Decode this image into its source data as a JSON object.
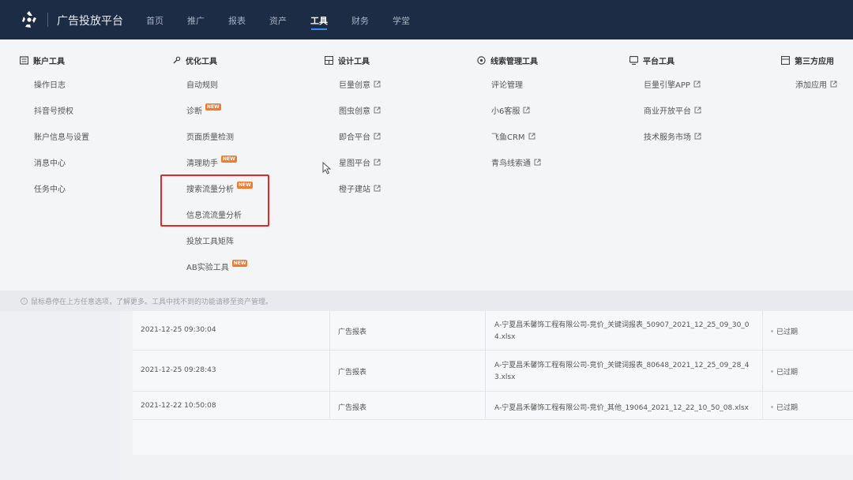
{
  "header": {
    "brand": "广告投放平台",
    "nav": [
      {
        "label": "首页",
        "active": false
      },
      {
        "label": "推广",
        "active": false
      },
      {
        "label": "报表",
        "active": false
      },
      {
        "label": "资产",
        "active": false
      },
      {
        "label": "工具",
        "active": true
      },
      {
        "label": "财务",
        "active": false
      },
      {
        "label": "学堂",
        "active": false
      }
    ]
  },
  "tools_menu": {
    "columns": [
      {
        "title": "账户工具",
        "icon": "account-tools-icon",
        "items": [
          {
            "label": "操作日志"
          },
          {
            "label": "抖音号授权"
          },
          {
            "label": "账户信息与设置"
          },
          {
            "label": "消息中心"
          },
          {
            "label": "任务中心"
          }
        ]
      },
      {
        "title": "优化工具",
        "icon": "wrench-icon",
        "items": [
          {
            "label": "自动规则"
          },
          {
            "label": "诊断",
            "badge": "NEW"
          },
          {
            "label": "页面质量检测"
          },
          {
            "label": "清理助手",
            "badge": "NEW"
          },
          {
            "label": "搜索流量分析",
            "badge": "NEW"
          },
          {
            "label": "信息流流量分析"
          },
          {
            "label": "投放工具矩阵"
          },
          {
            "label": "AB实验工具",
            "badge": "NEW"
          }
        ]
      },
      {
        "title": "设计工具",
        "icon": "design-tools-icon",
        "items": [
          {
            "label": "巨量创意",
            "external": true
          },
          {
            "label": "图虫创意",
            "external": true
          },
          {
            "label": "即合平台",
            "external": true
          },
          {
            "label": "星图平台",
            "external": true
          },
          {
            "label": "橙子建站",
            "external": true
          }
        ]
      },
      {
        "title": "线索管理工具",
        "icon": "leads-tools-icon",
        "items": [
          {
            "label": "评论管理"
          },
          {
            "label": "小6客服",
            "external": true
          },
          {
            "label": "飞鱼CRM",
            "external": true
          },
          {
            "label": "青鸟线索通",
            "external": true
          }
        ]
      },
      {
        "title": "平台工具",
        "icon": "platform-tools-icon",
        "items": [
          {
            "label": "巨量引擎APP",
            "external": true
          },
          {
            "label": "商业开放平台",
            "external": true
          },
          {
            "label": "技术服务市场",
            "external": true
          }
        ]
      },
      {
        "title": "第三方应用",
        "icon": "third-party-icon",
        "items": [
          {
            "label": "添加应用",
            "external": true
          }
        ]
      }
    ]
  },
  "info_strip": {
    "text": "鼠标悬停在上方任意选项，了解更多。工具中找不到的功能请移至资产管理。"
  },
  "download_table": {
    "rows": [
      {
        "time": "2021-12-25 09:30:04",
        "type": "广告报表",
        "file_line1": "A-宁夏昌禾馨饰工程有限公司-竞价_关键词报表_50907_2021_12_25_09_30_0",
        "file_line2": "4.xlsx",
        "status": "已过期"
      },
      {
        "time": "2021-12-25 09:28:43",
        "type": "广告报表",
        "file_line1": "A-宁夏昌禾馨饰工程有限公司-竞价_关键词报表_80648_2021_12_25_09_28_4",
        "file_line2": "3.xlsx",
        "status": "已过期"
      },
      {
        "time": "2021-12-22 10:50:08",
        "type": "广告报表",
        "file_line1": "A-宁夏昌禾馨饰工程有限公司-竞价_其他_19064_2021_12_22_10_50_08.xlsx",
        "file_line2": "",
        "status": "已过期"
      }
    ]
  },
  "colors": {
    "nav_bg": "#1c2c44",
    "accent": "#3f87ff",
    "new_badge": "#f07a2e",
    "highlight": "#e02a2a"
  }
}
